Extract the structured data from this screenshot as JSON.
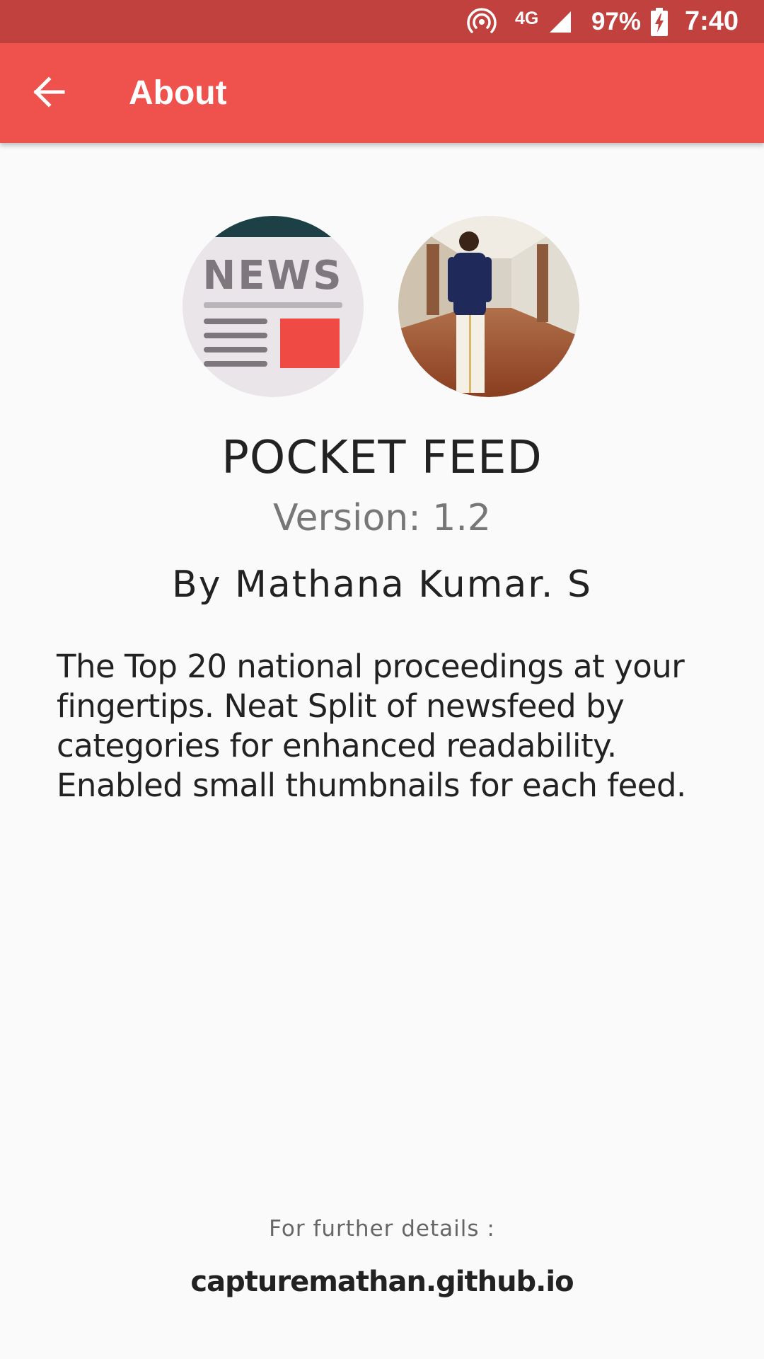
{
  "status_bar": {
    "network_type": "4G",
    "battery_percent": "97%",
    "time": "7:40",
    "icons": [
      "hotspot-icon",
      "signal-icon",
      "battery-charging-icon"
    ]
  },
  "app_bar": {
    "title": "About",
    "back_icon": "arrow-back-icon",
    "color": "#ef524c"
  },
  "logo": {
    "label": "NEWS"
  },
  "app_info": {
    "name": "POCKET FEED",
    "version": "Version: 1.2",
    "author": "By Mathana Kumar. S",
    "description": "The Top 20 national proceedings at your fingertips. Neat Split of newsfeed by categories for enhanced readability. Enabled small thumbnails for each feed."
  },
  "footer": {
    "details_label": "For further details :",
    "website": "capturemathan.github.io"
  }
}
